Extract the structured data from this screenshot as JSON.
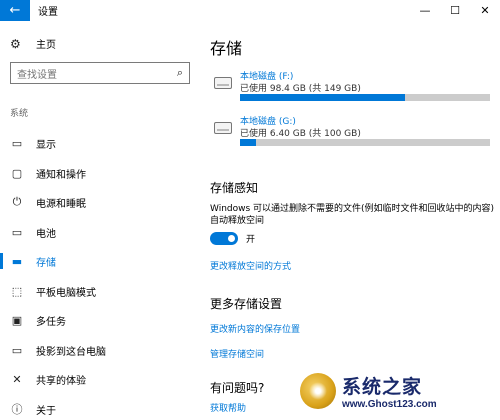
{
  "window": {
    "back_glyph": "←",
    "title": "设置",
    "minimize_glyph": "—",
    "maximize_glyph": "☐",
    "close_glyph": "✕"
  },
  "sidebar": {
    "home": {
      "icon": "gear-icon",
      "glyph": "⚙",
      "label": "主页"
    },
    "search": {
      "placeholder": "查找设置",
      "icon": "search-icon",
      "glyph": "⌕"
    },
    "section": "系统",
    "items": [
      {
        "icon": "display-icon",
        "glyph": "▭",
        "label": "显示",
        "active": false
      },
      {
        "icon": "notifications-icon",
        "glyph": "▢",
        "label": "通知和操作",
        "active": false
      },
      {
        "icon": "power-icon",
        "glyph": "⏻",
        "label": "电源和睡眠",
        "active": false
      },
      {
        "icon": "battery-icon",
        "glyph": "▭",
        "label": "电池",
        "active": false
      },
      {
        "icon": "storage-icon",
        "glyph": "▬",
        "label": "存储",
        "active": true
      },
      {
        "icon": "tablet-icon",
        "glyph": "⬚",
        "label": "平板电脑模式",
        "active": false
      },
      {
        "icon": "multitasking-icon",
        "glyph": "▣",
        "label": "多任务",
        "active": false
      },
      {
        "icon": "project-icon",
        "glyph": "▭",
        "label": "投影到这台电脑",
        "active": false
      },
      {
        "icon": "shared-experiences-icon",
        "glyph": "✕",
        "label": "共享的体验",
        "active": false
      },
      {
        "icon": "info-icon",
        "glyph": "ⓘ",
        "label": "关于",
        "active": false
      }
    ]
  },
  "main": {
    "title": "存储",
    "drives": [
      {
        "name": "本地磁盘 (F:)",
        "usage": "已使用 98.4 GB (共 149 GB)",
        "used_fraction": 0.66
      },
      {
        "name": "本地磁盘 (G:)",
        "usage": "已使用 6.40 GB (共 100 GB)",
        "used_fraction": 0.064
      }
    ],
    "storage_sense": {
      "heading": "存储感知",
      "description": "Windows 可以通过删除不需要的文件(例如临时文件和回收站中的内容)自动释放空间",
      "toggle_state": "开",
      "link": "更改释放空间的方式"
    },
    "more_settings": {
      "heading": "更多存储设置",
      "link_save_location": "更改新内容的保存位置",
      "link_manage_spaces": "管理存储空间"
    },
    "help": {
      "heading": "有问题吗?",
      "link": "获取帮助"
    }
  },
  "watermark": {
    "title": "系统之家",
    "url": "www.Ghost123.com"
  },
  "colors": {
    "accent": "#0078d7",
    "bar_track": "#cccccc"
  }
}
